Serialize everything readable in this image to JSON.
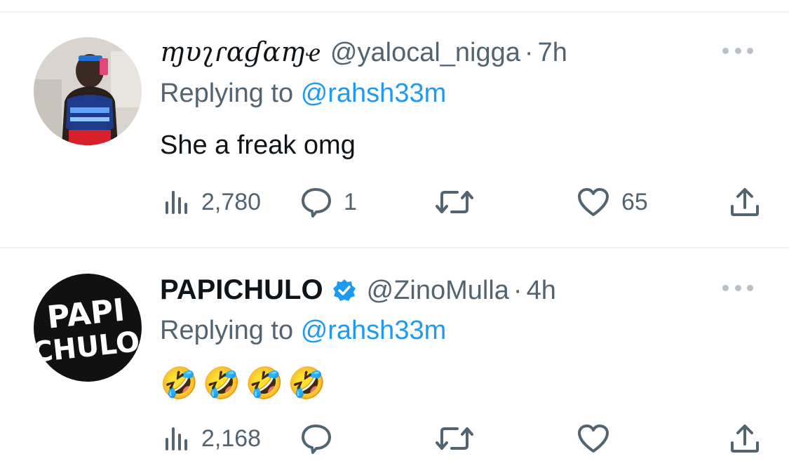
{
  "tweets": [
    {
      "display_name": "ɱυʅɾαɠαɱҽ",
      "handle": "@yalocal_nigga",
      "separator": "·",
      "time": "7h",
      "replying_prefix": "Replying to",
      "replying_to": "@rahsh33m",
      "text": "She a freak omg",
      "verified": false,
      "stats": {
        "views": "2,780",
        "replies": "1",
        "retweets": "",
        "likes": "65"
      }
    },
    {
      "display_name": "PAPICHULO",
      "handle": "@ZinoMulla",
      "separator": "·",
      "time": "4h",
      "replying_prefix": "Replying to",
      "replying_to": "@rahsh33m",
      "text": "🤣🤣🤣🤣",
      "verified": true,
      "stats": {
        "views": "2,168",
        "replies": "",
        "retweets": "",
        "likes": ""
      },
      "avatar_text": {
        "line1": "PAPI",
        "line2": "CHULO"
      }
    }
  ],
  "icons": {
    "views": "bar-chart-icon",
    "reply": "speech-bubble-icon",
    "retweet": "retweet-arrows-icon",
    "like": "heart-icon",
    "share": "share-upload-icon",
    "more": "more-dots-icon",
    "verified": "verified-badge-icon"
  },
  "colors": {
    "link": "#1d9bf0",
    "secondary_text": "#536471",
    "primary_text": "#0f1419",
    "divider": "#eff3f4"
  }
}
